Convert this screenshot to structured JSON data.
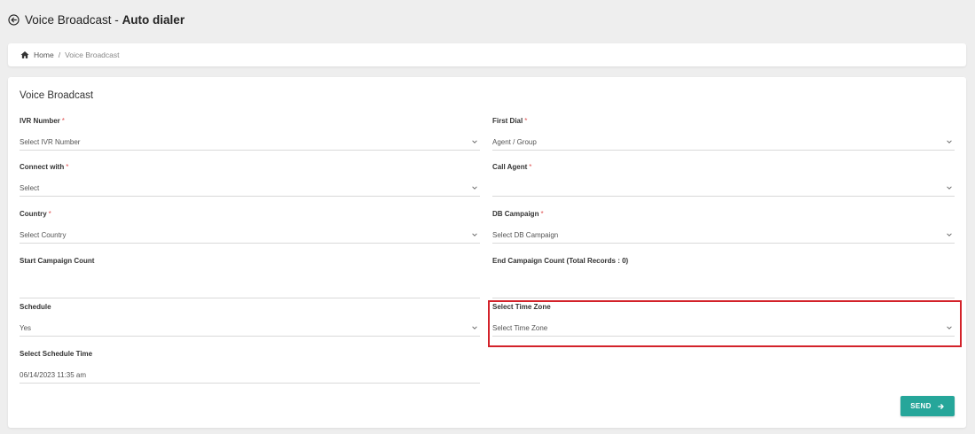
{
  "header": {
    "title_prefix": "Voice Broadcast - ",
    "title_strong": "Auto dialer",
    "back_icon": "circle-arrow-left-icon"
  },
  "breadcrumb": {
    "home_icon": "home-icon",
    "home": "Home",
    "separator": "/",
    "current": "Voice Broadcast"
  },
  "form": {
    "title": "Voice Broadcast",
    "required_marker": "*",
    "fields": {
      "ivr_number": {
        "label": "IVR Number",
        "value": "Select IVR Number"
      },
      "first_dial": {
        "label": "First Dial",
        "value": "Agent / Group"
      },
      "connect_with": {
        "label": "Connect with",
        "value": "Select"
      },
      "call_agent": {
        "label": "Call Agent",
        "value": ""
      },
      "country": {
        "label": "Country",
        "value": "Select Country"
      },
      "db_campaign": {
        "label": "DB Campaign",
        "value": "Select DB Campaign"
      },
      "start_campaign_count": {
        "label": "Start Campaign Count",
        "value": ""
      },
      "end_campaign_count": {
        "label": "End Campaign Count (Total Records : 0)",
        "value": ""
      },
      "schedule": {
        "label": "Schedule",
        "value": "Yes"
      },
      "time_zone": {
        "label": "Select Time Zone",
        "value": "Select Time Zone"
      },
      "schedule_time": {
        "label": "Select Schedule Time",
        "value": "06/14/2023 11:35 am"
      }
    },
    "send_label": "SEND",
    "send_icon": "arrow-right-icon"
  },
  "colors": {
    "accent": "#26a69a",
    "highlight": "#d3222a",
    "required": "#e05555",
    "background": "#eeeeee"
  }
}
